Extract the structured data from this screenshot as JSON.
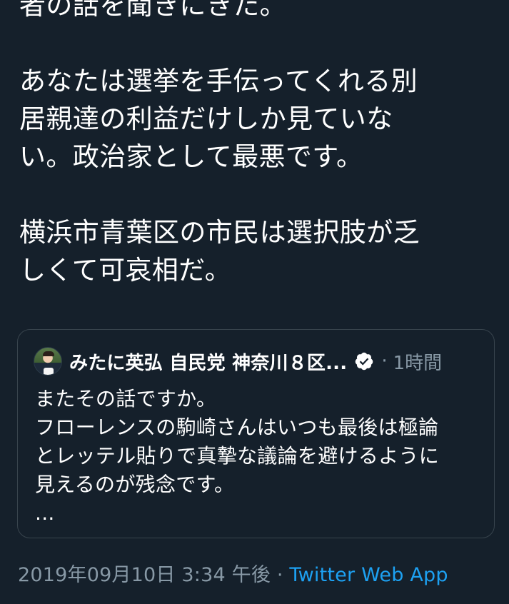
{
  "tweet": {
    "lines": [
      "者の話を聞きにきた。",
      "",
      "あなたは選挙を手伝ってくれる別",
      "居親達の利益だけしか見ていな",
      "い。政治家として最悪です。",
      "",
      "横浜市青葉区の市民は選択肢が乏",
      "しくて可哀相だ。"
    ]
  },
  "quote": {
    "name": "みたに英弘 自民党 神奈川８区...",
    "separator": "·",
    "time": "1時間",
    "verified_icon": "verified-badge-icon",
    "lines": [
      "またその話ですか。",
      "フローレンスの駒崎さんはいつも最後は極論",
      "とレッテル貼りで真摯な議論を避けるように",
      "見えるのが残念です。",
      "..."
    ]
  },
  "footer": {
    "timestamp": "2019年09月10日 3:34 午後",
    "separator": " · ",
    "source": "Twitter Web App"
  },
  "colors": {
    "background": "#15202b",
    "text": "#ffffff",
    "muted": "#8899a6",
    "link": "#1da1f2",
    "border": "#38444d"
  }
}
